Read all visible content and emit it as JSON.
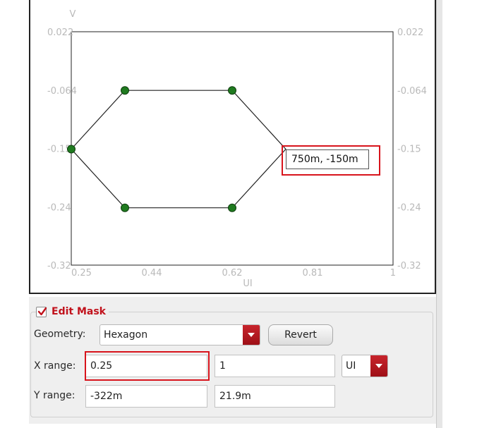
{
  "plot": {
    "y_axis_label": "V",
    "x_axis_label": "UI",
    "y_ticks": [
      "0.022",
      "-0.064",
      "-0.15",
      "-0.24",
      "-0.32"
    ],
    "y_ticks_right": [
      "0.022",
      "-0.064",
      "-0.15",
      "-0.24",
      "-0.32"
    ],
    "x_ticks": [
      "0.25",
      "0.44",
      "0.62",
      "0.81",
      "1"
    ],
    "tooltip": "750m, -150m",
    "line_color": "#222222",
    "vertex_color": "#1f7a1f"
  },
  "chart_data": {
    "type": "line",
    "title": "",
    "xlabel": "UI",
    "ylabel": "V",
    "xlim": [
      0.25,
      1
    ],
    "ylim": [
      -0.32,
      0.022
    ],
    "grid": true,
    "series": [
      {
        "x": [
          0.25,
          0.375,
          0.625,
          0.75,
          0.625,
          0.375,
          0.25
        ],
        "y": [
          -0.15,
          -0.064,
          -0.064,
          -0.15,
          -0.236,
          -0.236,
          -0.15
        ]
      }
    ],
    "vertices": {
      "x": [
        0.25,
        0.375,
        0.625,
        0.625,
        0.375
      ],
      "y": [
        -0.15,
        -0.064,
        -0.064,
        -0.236,
        -0.236
      ]
    },
    "hover_point": {
      "x": 0.75,
      "y": -0.15
    }
  },
  "panel": {
    "group_title": "Edit Mask",
    "edit_mask_checked": true,
    "geometry_label": "Geometry:",
    "geometry_value": "Hexagon",
    "revert_label": "Revert",
    "x_range_label": "X range:",
    "x_min": "0.25",
    "x_max": "1",
    "x_unit": "UI",
    "y_range_label": "Y range:",
    "y_min": "-322m",
    "y_max": "21.9m"
  },
  "colors": {
    "accent": "#c1121c",
    "highlight": "#d8141c"
  }
}
